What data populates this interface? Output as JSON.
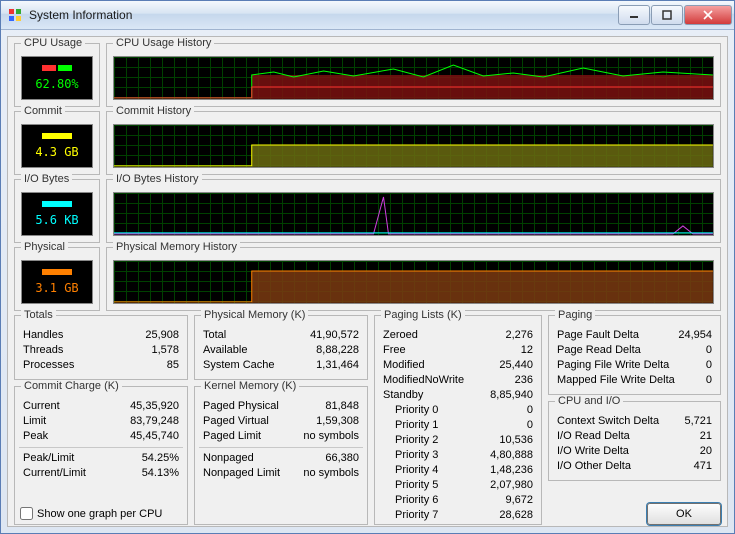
{
  "window": {
    "title": "System Information"
  },
  "meters": {
    "cpu": {
      "label": "CPU Usage",
      "history_label": "CPU Usage History",
      "value": "62.80%",
      "color": "#00ff00",
      "fill": "#7a1010"
    },
    "commit": {
      "label": "Commit",
      "history_label": "Commit History",
      "value": "4.3 GB",
      "color": "#ffff00",
      "fill": "#6a6a10"
    },
    "iobytes": {
      "label": "I/O Bytes",
      "history_label": "I/O Bytes History",
      "value": "5.6  KB",
      "color": "#00ffff",
      "fill": "#b030c0"
    },
    "physical": {
      "label": "Physical",
      "history_label": "Physical Memory History",
      "value": "3.1 GB",
      "color": "#ff8000",
      "fill": "#7a3a10"
    }
  },
  "totals": {
    "title": "Totals",
    "handles_label": "Handles",
    "handles": "25,908",
    "threads_label": "Threads",
    "threads": "1,578",
    "processes_label": "Processes",
    "processes": "85"
  },
  "commit_charge": {
    "title": "Commit Charge (K)",
    "current_label": "Current",
    "current": "45,35,920",
    "limit_label": "Limit",
    "limit": "83,79,248",
    "peak_label": "Peak",
    "peak": "45,45,740",
    "peak_limit_label": "Peak/Limit",
    "peak_limit": "54.25%",
    "current_limit_label": "Current/Limit",
    "current_limit": "54.13%"
  },
  "physical_memory": {
    "title": "Physical Memory (K)",
    "total_label": "Total",
    "total": "41,90,572",
    "available_label": "Available",
    "available": "8,88,228",
    "system_cache_label": "System Cache",
    "system_cache": "1,31,464"
  },
  "kernel_memory": {
    "title": "Kernel Memory (K)",
    "paged_physical_label": "Paged Physical",
    "paged_physical": "81,848",
    "paged_virtual_label": "Paged Virtual",
    "paged_virtual": "1,59,308",
    "paged_limit_label": "Paged Limit",
    "paged_limit": "no symbols",
    "nonpaged_label": "Nonpaged",
    "nonpaged": "66,380",
    "nonpaged_limit_label": "Nonpaged Limit",
    "nonpaged_limit": "no symbols"
  },
  "paging_lists": {
    "title": "Paging Lists (K)",
    "zeroed_label": "Zeroed",
    "zeroed": "2,276",
    "free_label": "Free",
    "free": "12",
    "modified_label": "Modified",
    "modified": "25,440",
    "modified_nowrite_label": "ModifiedNoWrite",
    "modified_nowrite": "236",
    "standby_label": "Standby",
    "standby": "8,85,940",
    "p0_label": "Priority 0",
    "p0": "0",
    "p1_label": "Priority 1",
    "p1": "0",
    "p2_label": "Priority 2",
    "p2": "10,536",
    "p3_label": "Priority 3",
    "p3": "4,80,888",
    "p4_label": "Priority 4",
    "p4": "1,48,236",
    "p5_label": "Priority 5",
    "p5": "2,07,980",
    "p6_label": "Priority 6",
    "p6": "9,672",
    "p7_label": "Priority 7",
    "p7": "28,628"
  },
  "paging": {
    "title": "Paging",
    "page_fault_label": "Page Fault Delta",
    "page_fault": "24,954",
    "page_read_label": "Page Read Delta",
    "page_read": "0",
    "paging_file_write_label": "Paging File Write Delta",
    "paging_file_write": "0",
    "mapped_file_write_label": "Mapped File Write Delta",
    "mapped_file_write": "0"
  },
  "cpu_io": {
    "title": "CPU and I/O",
    "context_switch_label": "Context Switch Delta",
    "context_switch": "5,721",
    "io_read_label": "I/O Read Delta",
    "io_read": "21",
    "io_write_label": "I/O Write Delta",
    "io_write": "20",
    "io_other_label": "I/O Other Delta",
    "io_other": "471"
  },
  "footer": {
    "checkbox_label": "Show one graph per CPU",
    "ok_label": "OK"
  },
  "chart_data": [
    {
      "type": "area",
      "name": "CPU Usage History",
      "y_range": [
        0,
        100
      ],
      "note": "noisy ~55–75% after step, near 0% before step at ~23% width",
      "step_at_fraction": 0.23
    },
    {
      "type": "area",
      "name": "Commit History",
      "y_range": [
        0,
        8.4
      ],
      "unit": "GB",
      "flat_value_after_step": 4.3,
      "step_at_fraction": 0.23
    },
    {
      "type": "line",
      "name": "I/O Bytes History",
      "note": "mostly near zero with a single spike near 45% width"
    },
    {
      "type": "area",
      "name": "Physical Memory History",
      "y_range": [
        0,
        4.0
      ],
      "unit": "GB",
      "flat_value_after_step": 3.1,
      "step_at_fraction": 0.23
    }
  ]
}
